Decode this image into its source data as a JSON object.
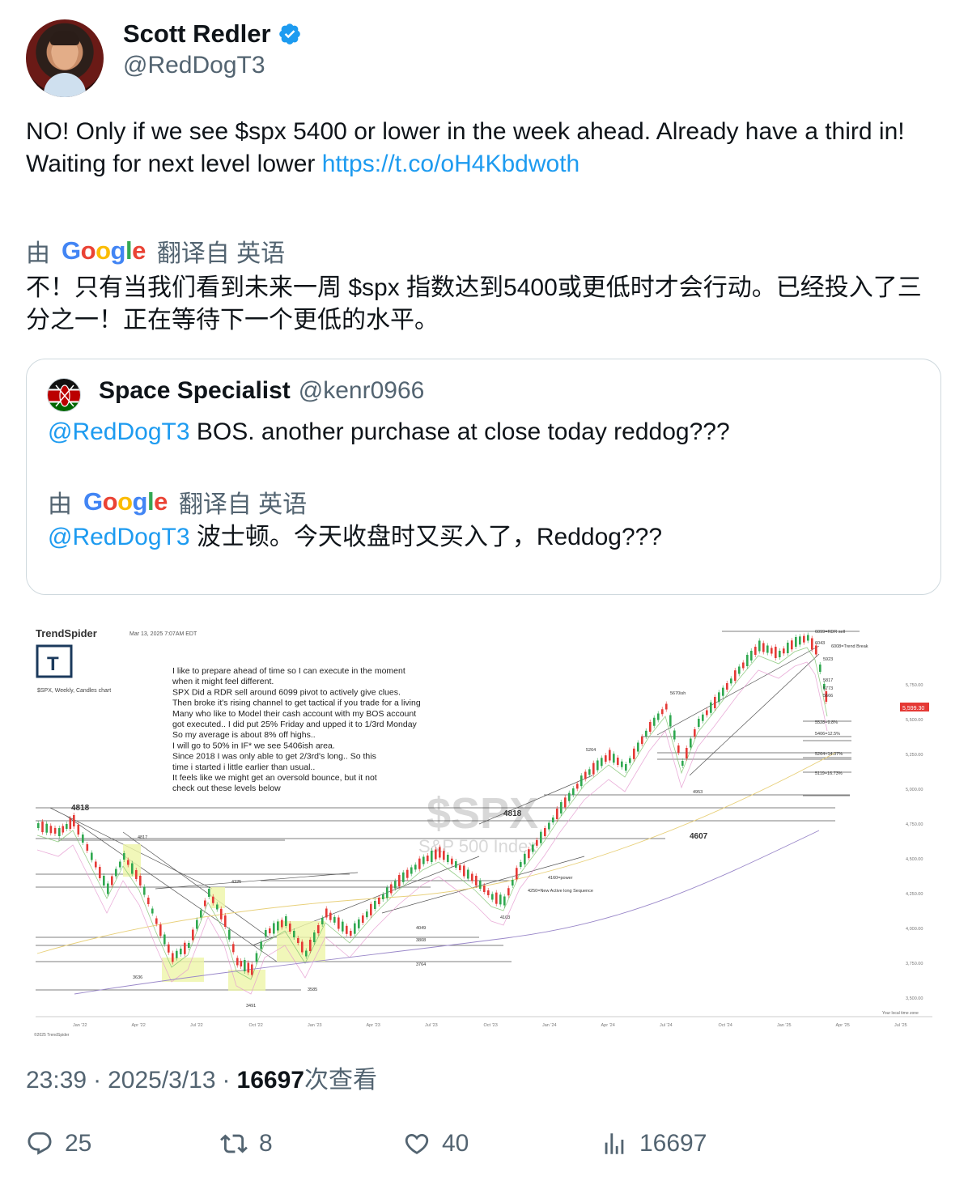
{
  "author": {
    "name": "Scott Redler",
    "handle": "@RedDogT3"
  },
  "tweet": {
    "line1": "NO!  Only if we see $spx 5400 or lower in the week ahead.  Already have a third in!",
    "line2_prefix": "Waiting for next level lower ",
    "link": "https://t.co/oH4Kbdwoth",
    "translate_by": "由",
    "translate_from": "翻译自 英语",
    "translated_text": "不！只有当我们看到未来一周 $spx 指数达到5400或更低时才会行动。已经投入了三分之一！正在等待下一个更低的水平。"
  },
  "quote": {
    "name": "Space Specialist",
    "handle": "@kenr0966",
    "mention": "@RedDogT3",
    "text": " BOS. another purchase at close today reddog???",
    "translate_by": "由",
    "translate_from": "翻译自 英语",
    "translated_mention": "@RedDogT3",
    "translated_text": " 波士顿。今天收盘时又买入了，Reddog???"
  },
  "google_logo": "Google",
  "chart_image": {
    "brand": "TrendSpider",
    "date": "Mar 13, 2025 7:07AM EDT",
    "subtitle": "$SPX, Weekly, Candles chart",
    "watermark": "$SPX",
    "watermark_sub": "S&P 500 Index",
    "notes": [
      "I like to prepare ahead of time so I can execute in the moment",
      "when it might feel different.",
      "SPX Did a RDR sell around 6099 pivot to actively give clues.",
      "Then broke it's rising channel to get tactical if you trade for a living",
      "Many who like to Model their cash account with my BOS account",
      "got executed.. I did put 25% Friday and upped it to 1/3rd Monday",
      "So my average is about 8% off highs..",
      "I will go to 50% in IF* we see 5406ish area.",
      "Since 2018 I was only able to get 2/3rd's long.. So this",
      "time i started i little earlier than usual..",
      "It feels like we might get an oversold bounce, but it not",
      "check out these levels below"
    ],
    "levels": [
      "6099=RDR sell",
      "6043",
      "6008=Trend Break",
      "5923",
      "5817",
      "5773",
      "5666",
      "5528=9.8%",
      "5406=12.5%",
      "5264=14.37%",
      "5119=16.73%",
      "5670ish",
      "5264",
      "4953",
      "4818",
      "4607",
      "4160=power",
      "4250=New Active long Sequence",
      "4103",
      "4049",
      "3808",
      "3764",
      "4325",
      "4817",
      "4818",
      "3636",
      "3585",
      "3491"
    ],
    "price_tag": "5,599.30",
    "y_ticks": [
      "5,750.00",
      "5,500.00",
      "5,250.00",
      "5,000.00",
      "4,750.00",
      "4,500.00",
      "4,250.00",
      "4,000.00",
      "3,750.00",
      "3,500.00"
    ],
    "x_ticks": [
      "Jan '22",
      "Apr '22",
      "Jul '22",
      "Oct '22",
      "Jan '23",
      "Apr '23",
      "Jul '23",
      "Oct '23",
      "Jan '24",
      "Apr '24",
      "Jul '24",
      "Oct '24",
      "Jan '25",
      "Apr '25",
      "Jul '25"
    ],
    "copyright": "©2025 TrendSpider",
    "timezone": "Your local time zone"
  },
  "meta": {
    "time": "23:39",
    "sep": "·",
    "date": "2025/3/13",
    "views": "16697",
    "views_label": "次查看"
  },
  "actions": {
    "replies": "25",
    "reposts": "8",
    "likes": "40",
    "views": "16697"
  }
}
